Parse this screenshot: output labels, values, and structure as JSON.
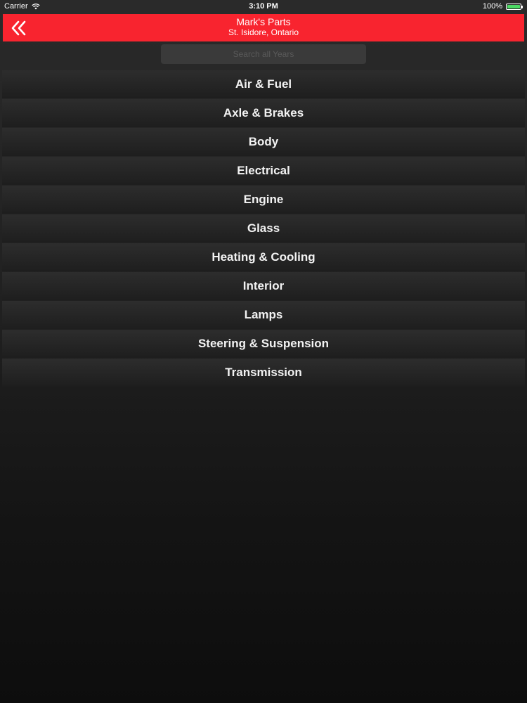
{
  "status_bar": {
    "carrier": "Carrier",
    "time": "3:10 PM",
    "battery_percent": "100%",
    "battery_level": 1.0,
    "wifi_icon": "wifi-icon",
    "battery_icon": "battery-icon",
    "battery_color": "#4cd964"
  },
  "header": {
    "title": "Mark's Parts",
    "subtitle": "St. Isidore, Ontario",
    "back_icon": "double-chevron-left-icon",
    "background_color": "#f8242f"
  },
  "search": {
    "placeholder": "Search all Years"
  },
  "categories": [
    {
      "label": "Air & Fuel"
    },
    {
      "label": "Axle & Brakes"
    },
    {
      "label": "Body"
    },
    {
      "label": "Electrical"
    },
    {
      "label": "Engine"
    },
    {
      "label": "Glass"
    },
    {
      "label": "Heating & Cooling"
    },
    {
      "label": "Interior"
    },
    {
      "label": "Lamps"
    },
    {
      "label": "Steering & Suspension"
    },
    {
      "label": "Transmission"
    }
  ]
}
